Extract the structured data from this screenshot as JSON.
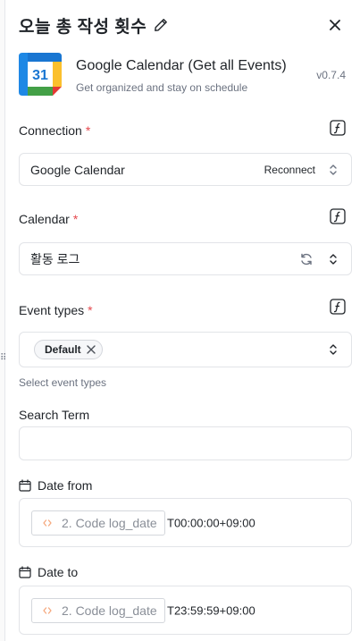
{
  "header": {
    "title": "오늘 총 작성 횟수",
    "edit_icon": "pencil-icon",
    "close_icon": "close-icon"
  },
  "app": {
    "name": "Google Calendar (Get all Events)",
    "description": "Get organized and stay on schedule",
    "version": "v0.7.4",
    "logo_text": "31"
  },
  "connection": {
    "label": "Connection",
    "required_mark": "*",
    "value": "Google Calendar",
    "action_label": "Reconnect"
  },
  "calendar": {
    "label": "Calendar",
    "required_mark": "*",
    "value": "활동 로그"
  },
  "event_types": {
    "label": "Event types",
    "required_mark": "*",
    "chip": "Default",
    "hint": "Select event types"
  },
  "search_term": {
    "label": "Search Term",
    "value": ""
  },
  "date_from": {
    "label": "Date from",
    "code_ref": "2. Code log_date",
    "suffix": "T00:00:00+09:00"
  },
  "date_to": {
    "label": "Date to",
    "code_ref": "2. Code log_date",
    "suffix": "T23:59:59+09:00"
  },
  "colors": {
    "required": "#e5484d",
    "muted": "#6b7280",
    "border": "#e2e4e8",
    "code_icon": "#f5a97f"
  }
}
